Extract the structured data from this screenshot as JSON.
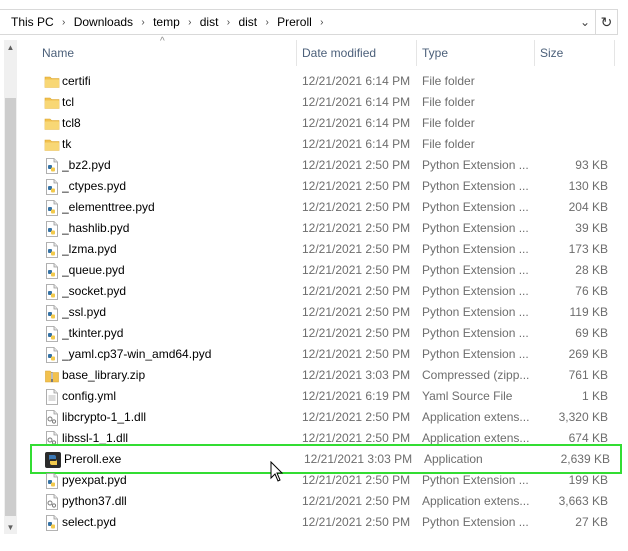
{
  "address": {
    "crumbs": [
      "This PC",
      "Downloads",
      "temp",
      "dist",
      "dist",
      "Preroll"
    ],
    "separator": "›",
    "chevron": "⌄",
    "refresh": "↻"
  },
  "columns": {
    "name": "Name",
    "date": "Date modified",
    "type": "Type",
    "size": "Size",
    "sort_indicator": "^"
  },
  "colors": {
    "folder": "#f2c14e",
    "selection_border": "#33dd33",
    "header_text": "#4c607a"
  },
  "files": [
    {
      "name": "certifi",
      "date": "12/21/2021 6:14 PM",
      "type": "File folder",
      "size": "",
      "icon": "folder-icon"
    },
    {
      "name": "tcl",
      "date": "12/21/2021 6:14 PM",
      "type": "File folder",
      "size": "",
      "icon": "folder-icon"
    },
    {
      "name": "tcl8",
      "date": "12/21/2021 6:14 PM",
      "type": "File folder",
      "size": "",
      "icon": "folder-icon"
    },
    {
      "name": "tk",
      "date": "12/21/2021 6:14 PM",
      "type": "File folder",
      "size": "",
      "icon": "folder-icon"
    },
    {
      "name": "_bz2.pyd",
      "date": "12/21/2021 2:50 PM",
      "type": "Python Extension ...",
      "size": "93 KB",
      "icon": "python-file-icon"
    },
    {
      "name": "_ctypes.pyd",
      "date": "12/21/2021 2:50 PM",
      "type": "Python Extension ...",
      "size": "130 KB",
      "icon": "python-file-icon"
    },
    {
      "name": "_elementtree.pyd",
      "date": "12/21/2021 2:50 PM",
      "type": "Python Extension ...",
      "size": "204 KB",
      "icon": "python-file-icon"
    },
    {
      "name": "_hashlib.pyd",
      "date": "12/21/2021 2:50 PM",
      "type": "Python Extension ...",
      "size": "39 KB",
      "icon": "python-file-icon"
    },
    {
      "name": "_lzma.pyd",
      "date": "12/21/2021 2:50 PM",
      "type": "Python Extension ...",
      "size": "173 KB",
      "icon": "python-file-icon"
    },
    {
      "name": "_queue.pyd",
      "date": "12/21/2021 2:50 PM",
      "type": "Python Extension ...",
      "size": "28 KB",
      "icon": "python-file-icon"
    },
    {
      "name": "_socket.pyd",
      "date": "12/21/2021 2:50 PM",
      "type": "Python Extension ...",
      "size": "76 KB",
      "icon": "python-file-icon"
    },
    {
      "name": "_ssl.pyd",
      "date": "12/21/2021 2:50 PM",
      "type": "Python Extension ...",
      "size": "119 KB",
      "icon": "python-file-icon"
    },
    {
      "name": "_tkinter.pyd",
      "date": "12/21/2021 2:50 PM",
      "type": "Python Extension ...",
      "size": "69 KB",
      "icon": "python-file-icon"
    },
    {
      "name": "_yaml.cp37-win_amd64.pyd",
      "date": "12/21/2021 2:50 PM",
      "type": "Python Extension ...",
      "size": "269 KB",
      "icon": "python-file-icon"
    },
    {
      "name": "base_library.zip",
      "date": "12/21/2021 3:03 PM",
      "type": "Compressed (zipp...",
      "size": "761 KB",
      "icon": "zip-file-icon"
    },
    {
      "name": "config.yml",
      "date": "12/21/2021 6:19 PM",
      "type": "Yaml Source File",
      "size": "1 KB",
      "icon": "text-file-icon"
    },
    {
      "name": "libcrypto-1_1.dll",
      "date": "12/21/2021 2:50 PM",
      "type": "Application extens...",
      "size": "3,320 KB",
      "icon": "dll-file-icon"
    },
    {
      "name": "libssl-1_1.dll",
      "date": "12/21/2021 2:50 PM",
      "type": "Application extens...",
      "size": "674 KB",
      "icon": "dll-file-icon"
    },
    {
      "name": "Preroll.exe",
      "date": "12/21/2021 3:03 PM",
      "type": "Application",
      "size": "2,639 KB",
      "icon": "python-exe-icon",
      "selected": true
    },
    {
      "name": "pyexpat.pyd",
      "date": "12/21/2021 2:50 PM",
      "type": "Python Extension ...",
      "size": "199 KB",
      "icon": "python-file-icon"
    },
    {
      "name": "python37.dll",
      "date": "12/21/2021 2:50 PM",
      "type": "Application extens...",
      "size": "3,663 KB",
      "icon": "dll-file-icon"
    },
    {
      "name": "select.pyd",
      "date": "12/21/2021 2:50 PM",
      "type": "Python Extension ...",
      "size": "27 KB",
      "icon": "python-file-icon"
    }
  ]
}
